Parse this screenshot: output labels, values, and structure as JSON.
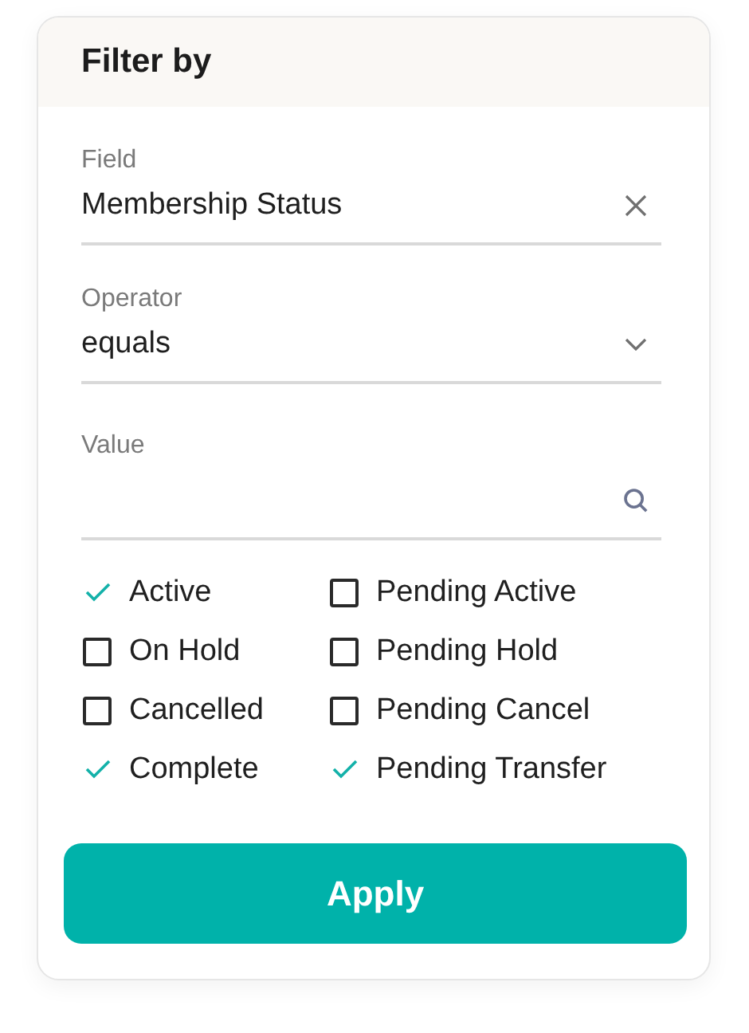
{
  "panel": {
    "title": "Filter by"
  },
  "fields": [
    {
      "label": "Field",
      "value": "Membership Status",
      "kind": "clear"
    },
    {
      "label": "Operator",
      "value": "equals",
      "kind": "select"
    },
    {
      "label": "Value",
      "kind": "search"
    }
  ],
  "options": [
    {
      "label": "Active",
      "checked": true
    },
    {
      "label": "Pending Active",
      "checked": false
    },
    {
      "label": "On Hold",
      "checked": false
    },
    {
      "label": "Pending Hold",
      "checked": false
    },
    {
      "label": "Cancelled",
      "checked": false
    },
    {
      "label": "Pending Cancel",
      "checked": false
    },
    {
      "label": "Complete",
      "checked": true
    },
    {
      "label": "Pending Transfer",
      "checked": true
    }
  ],
  "buttons": [
    {
      "label": "Apply"
    }
  ]
}
